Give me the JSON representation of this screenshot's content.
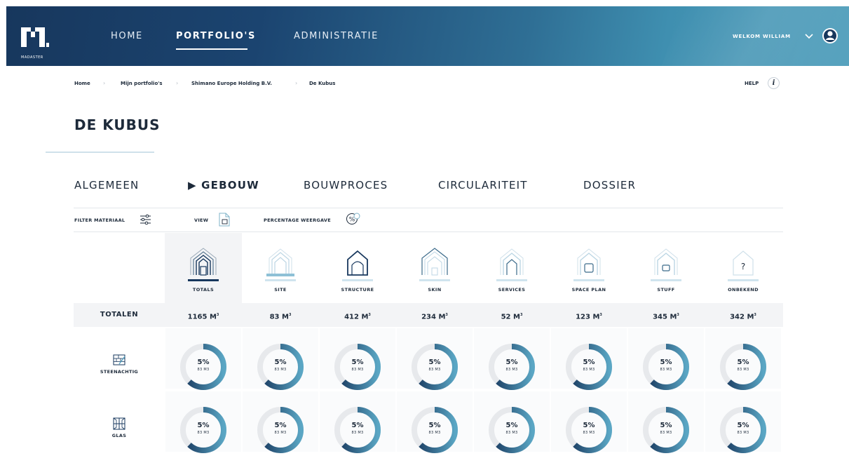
{
  "brand": {
    "logo_text": "MADASTER"
  },
  "nav": {
    "items": [
      "HOME",
      "PORTFOLIO'S",
      "ADMINISTRATIE"
    ],
    "active": "PORTFOLIO'S"
  },
  "user": {
    "welcome": "WELKOM WILLIAM"
  },
  "breadcrumb": [
    "Home",
    "Mijn portfolio's",
    "Shimano Europe Holding B.V.",
    "De Kubus"
  ],
  "help": {
    "label": "HELP",
    "icon_glyph": "i"
  },
  "page": {
    "title": "DE KUBUS"
  },
  "tabs": {
    "items": [
      "ALGEMEEN",
      "▶ GEBOUW",
      "BOUWPROCES",
      "CIRCULARITEIT",
      "DOSSIER"
    ],
    "active": "▶ GEBOUW"
  },
  "filters": {
    "filter_label": "FILTER MATERIAAL",
    "view_label": "VIEW",
    "percentage_label": "PERCENTAGE WEERGAVE"
  },
  "categories": [
    {
      "label": "TOTALS",
      "icon": "house-layers-icon",
      "active": true
    },
    {
      "label": "SITE",
      "icon": "house-site-icon"
    },
    {
      "label": "STRUCTURE",
      "icon": "house-structure-icon"
    },
    {
      "label": "SKIN",
      "icon": "house-skin-icon"
    },
    {
      "label": "SERVICES",
      "icon": "house-services-icon"
    },
    {
      "label": "SPACE PLAN",
      "icon": "house-space-plan-icon"
    },
    {
      "label": "STUFF",
      "icon": "house-stuff-icon"
    },
    {
      "label": "ONBEKEND",
      "icon": "house-unknown-icon",
      "glyph": "?"
    }
  ],
  "totals": {
    "label": "TOTALEN",
    "values": [
      "1165 M",
      "83 M",
      "412 M",
      "234 M",
      "52 M",
      "123 M",
      "345 M",
      "342 M"
    ],
    "unit_sup": "3"
  },
  "rows": [
    {
      "label": "STEENACHTIG",
      "icon": "brick-wall-icon",
      "cells": [
        {
          "pct": "5%",
          "sub": "83 M3",
          "fraction": 0.62
        },
        {
          "pct": "5%",
          "sub": "83 M3",
          "fraction": 0.62
        },
        {
          "pct": "5%",
          "sub": "83 M3",
          "fraction": 0.62
        },
        {
          "pct": "5%",
          "sub": "83 M3",
          "fraction": 0.62
        },
        {
          "pct": "5%",
          "sub": "83 M3",
          "fraction": 0.62
        },
        {
          "pct": "5%",
          "sub": "83 M3",
          "fraction": 0.62
        },
        {
          "pct": "5%",
          "sub": "83 M3",
          "fraction": 0.62
        },
        {
          "pct": "5%",
          "sub": "83 M3",
          "fraction": 0.62
        }
      ]
    },
    {
      "label": "GLAS",
      "icon": "window-icon",
      "cells": [
        {
          "pct": "5%",
          "sub": "83 M3",
          "fraction": 0.62
        },
        {
          "pct": "5%",
          "sub": "83 M3",
          "fraction": 0.62
        },
        {
          "pct": "5%",
          "sub": "83 M3",
          "fraction": 0.62
        },
        {
          "pct": "5%",
          "sub": "83 M3",
          "fraction": 0.62
        },
        {
          "pct": "5%",
          "sub": "83 M3",
          "fraction": 0.62
        },
        {
          "pct": "5%",
          "sub": "83 M3",
          "fraction": 0.62
        },
        {
          "pct": "5%",
          "sub": "83 M3",
          "fraction": 0.62
        },
        {
          "pct": "5%",
          "sub": "83 M3",
          "fraction": 0.62
        }
      ]
    }
  ],
  "colors": {
    "accent_dark": "#17375d",
    "accent_light": "#5aa6c4",
    "track": "#e7e9ec"
  }
}
